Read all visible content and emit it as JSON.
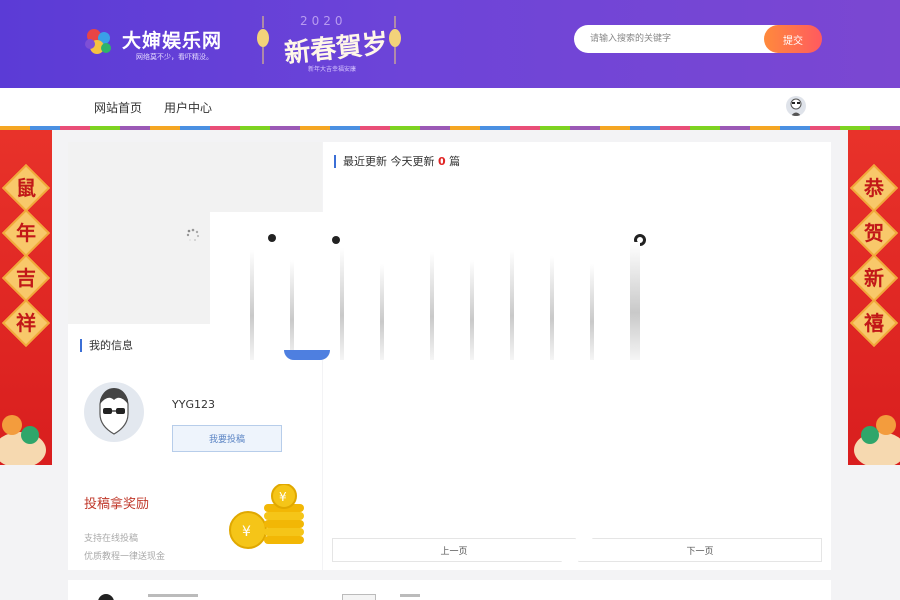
{
  "header": {
    "logo_title": "大婶娱乐网",
    "logo_subtitle": "网络莫不少，看吓精没。",
    "festival_year": "2020",
    "festival_text": "新春賀岁",
    "festival_sub": "新年大吉幸福安康",
    "search_placeholder": "请输入搜索的关键字",
    "search_button": "提交"
  },
  "nav": {
    "items": [
      {
        "label": "网站首页"
      },
      {
        "label": "用户中心"
      }
    ]
  },
  "banners": {
    "left_chars": [
      "鼠",
      "年",
      "吉",
      "祥"
    ],
    "right_chars": [
      "恭",
      "贺",
      "新",
      "禧"
    ]
  },
  "recent": {
    "title": "最近更新",
    "today_label": "今天更新",
    "today_count": "0",
    "unit": "篇",
    "prev_label": "上一页",
    "next_label": "下一页"
  },
  "profile": {
    "title": "我的信息",
    "username": "YYG123",
    "submit_button": "我要投稿"
  },
  "reward": {
    "title": "投稿拿奖励",
    "line1": "支持在线投稿",
    "line2": "优质教程一律送现金"
  },
  "colors": {
    "header_start": "#5b3bd6",
    "header_end": "#7b47d2",
    "accent_blue": "#3b6fd6",
    "banner_red": "#e8322a",
    "search_button": "#ff6a4c"
  }
}
